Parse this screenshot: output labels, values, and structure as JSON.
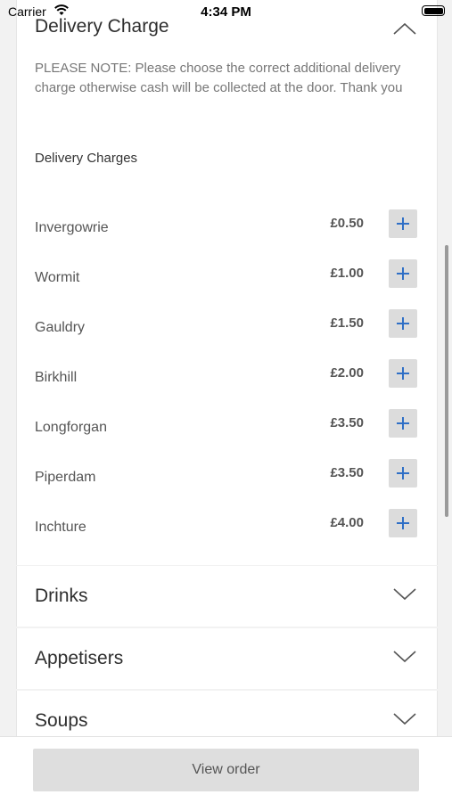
{
  "status_bar": {
    "carrier": "Carrier",
    "time": "4:34 PM"
  },
  "delivery_section": {
    "title": "Delivery Charge",
    "note": "PLEASE NOTE: Please choose the correct additional delivery charge otherwise cash will be collected at the door. Thank you",
    "subheading": "Delivery Charges",
    "expanded": true,
    "items": [
      {
        "name": "Invergowrie",
        "price": "£0.50"
      },
      {
        "name": "Wormit",
        "price": "£1.00"
      },
      {
        "name": "Gauldry",
        "price": "£1.50"
      },
      {
        "name": "Birkhill",
        "price": "£2.00"
      },
      {
        "name": "Longforgan",
        "price": "£3.50"
      },
      {
        "name": "Piperdam",
        "price": "£3.50"
      },
      {
        "name": "Inchture",
        "price": "£4.00"
      }
    ]
  },
  "sections": [
    {
      "title": "Drinks",
      "expanded": false
    },
    {
      "title": "Appetisers",
      "expanded": false
    },
    {
      "title": "Soups",
      "expanded": false
    }
  ],
  "footer": {
    "view_order_label": "View order"
  },
  "colors": {
    "accent": "#2f6fc6",
    "button_bg": "#dedede"
  },
  "icons": {
    "expand": "chevron-up-icon",
    "collapse": "chevron-down-icon",
    "add": "plus-icon"
  }
}
